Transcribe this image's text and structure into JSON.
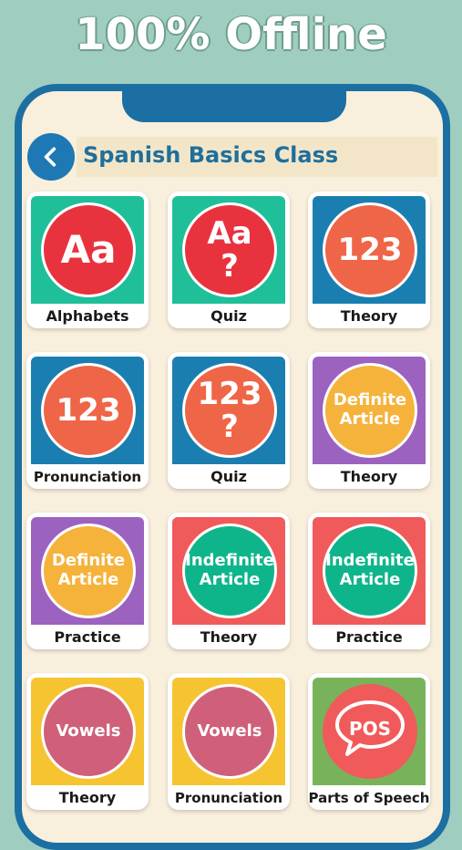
{
  "promo": {
    "title": "100% Offline"
  },
  "header": {
    "title": "Spanish Basics Class",
    "back_icon": "chevron-left-icon"
  },
  "colors": {
    "teal": "#1fbf9a",
    "blue": "#1a7fb0",
    "purple": "#9c62c0",
    "red": "#f15a5a",
    "yellow": "#f6c431",
    "green": "#78b35c",
    "circle_red": "#e8333f",
    "circle_orange": "#ef6547",
    "circle_yellow": "#f5b33b",
    "circle_green": "#0fb58a",
    "circle_pink": "#d0607a"
  },
  "tiles": [
    {
      "label": "Alphabets",
      "icon_line1": "Aa",
      "icon_line2": ""
    },
    {
      "label": "Quiz",
      "icon_line1": "Aa",
      "icon_line2": "?"
    },
    {
      "label": "Theory",
      "icon_line1": "123",
      "icon_line2": ""
    },
    {
      "label": "Pronunciation",
      "icon_line1": "123",
      "icon_line2": ""
    },
    {
      "label": "Quiz",
      "icon_line1": "123",
      "icon_line2": "?"
    },
    {
      "label": "Theory",
      "icon_line1": "Definite",
      "icon_line2": "Article"
    },
    {
      "label": "Practice",
      "icon_line1": "Definite",
      "icon_line2": "Article"
    },
    {
      "label": "Theory",
      "icon_line1": "Indefinite",
      "icon_line2": "Article"
    },
    {
      "label": "Practice",
      "icon_line1": "Indefinite",
      "icon_line2": "Article"
    },
    {
      "label": "Theory",
      "icon_line1": "Vowels",
      "icon_line2": ""
    },
    {
      "label": "Pronunciation",
      "icon_line1": "Vowels",
      "icon_line2": ""
    },
    {
      "label": "Parts of Speech",
      "icon_line1": "POS",
      "icon_line2": ""
    }
  ]
}
